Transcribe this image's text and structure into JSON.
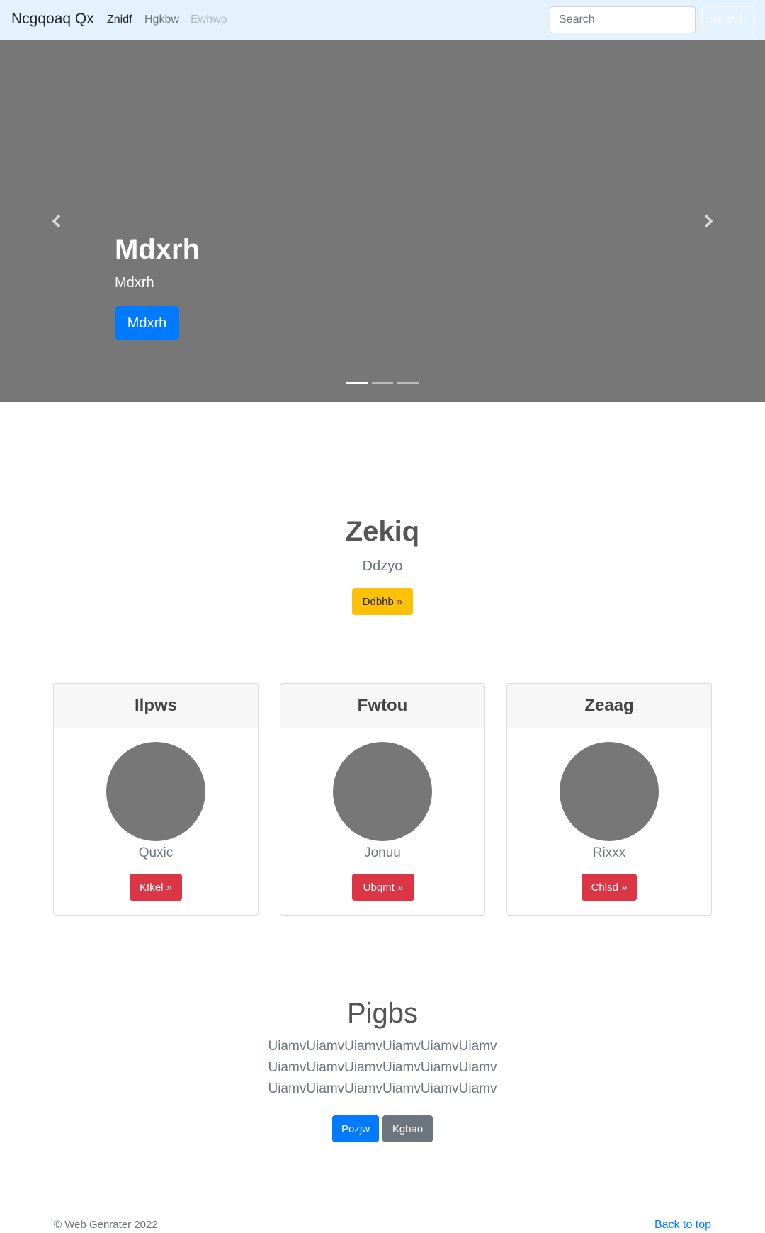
{
  "navbar": {
    "brand": "Ncgqoaq Qx",
    "links": [
      {
        "label": "Znidf",
        "state": "active"
      },
      {
        "label": "Hgkbw",
        "state": "normal"
      },
      {
        "label": "Ewhwp",
        "state": "disabled"
      }
    ],
    "search_placeholder": "Search",
    "search_button": "Search"
  },
  "carousel": {
    "title": "Mdxrh",
    "text": "Mdxrh",
    "button": "Mdxrh",
    "prev_icon": "chevron-left-icon",
    "next_icon": "chevron-right-icon",
    "slide_count": 3,
    "active_slide": 1
  },
  "hero": {
    "title": "Zekiq",
    "subtitle": "Ddzyo",
    "button": "Ddbhb »"
  },
  "cards": [
    {
      "header": "Ilpws",
      "name": "Quxic",
      "button": "Ktkel »"
    },
    {
      "header": "Fwtou",
      "name": "Jonuu",
      "button": "Ubqmt »"
    },
    {
      "header": "Zeaag",
      "name": "Rixxx",
      "button": "Chlsd »"
    }
  ],
  "album": {
    "title": "Pigbs",
    "lines": [
      "UiamvUiamvUiamvUiamvUiamvUiamv",
      "UiamvUiamvUiamvUiamvUiamvUiamv",
      "UiamvUiamvUiamvUiamvUiamvUiamv"
    ],
    "primary_button": "Pozjw",
    "secondary_button": "Kgbao"
  },
  "footer": {
    "copyright": "© Web Genrater 2022",
    "back_to_top": "Back to top"
  },
  "colors": {
    "navbar_bg": "#e3f2fd",
    "placeholder_gray": "#777777",
    "primary": "#007bff",
    "warning": "#ffc107",
    "danger": "#dc3545",
    "secondary": "#6c757d"
  }
}
